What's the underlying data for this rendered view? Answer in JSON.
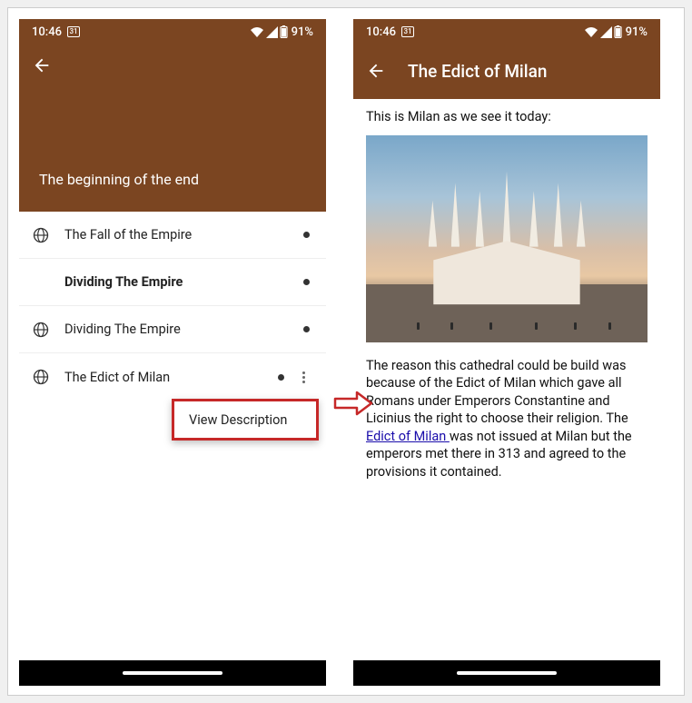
{
  "status": {
    "time": "10:46",
    "cal_day": "31",
    "battery": "91%"
  },
  "left": {
    "hero_title": "The beginning of the end",
    "rows": [
      {
        "label": "The Fall of the Empire",
        "globe": true,
        "bold": false,
        "more": false
      },
      {
        "label": "Dividing The Empire",
        "globe": false,
        "bold": true,
        "more": false
      },
      {
        "label": "Dividing The Empire",
        "globe": true,
        "bold": false,
        "more": false
      },
      {
        "label": "The Edict of Milan",
        "globe": true,
        "bold": false,
        "more": true
      }
    ],
    "popup_label": "View Description"
  },
  "right": {
    "app_title": "The Edict of Milan",
    "intro": "This is Milan as we see it today:",
    "para_pre": "The reason this cathedral could be build was because of the Edict of Milan which gave all Romans under Emperors Constantine and Licinius the right to choose their religion. The ",
    "link_text": "Edict of Milan ",
    "para_post": "was not issued at Milan but the emperors met there in 313 and agreed to the provisions it contained."
  }
}
